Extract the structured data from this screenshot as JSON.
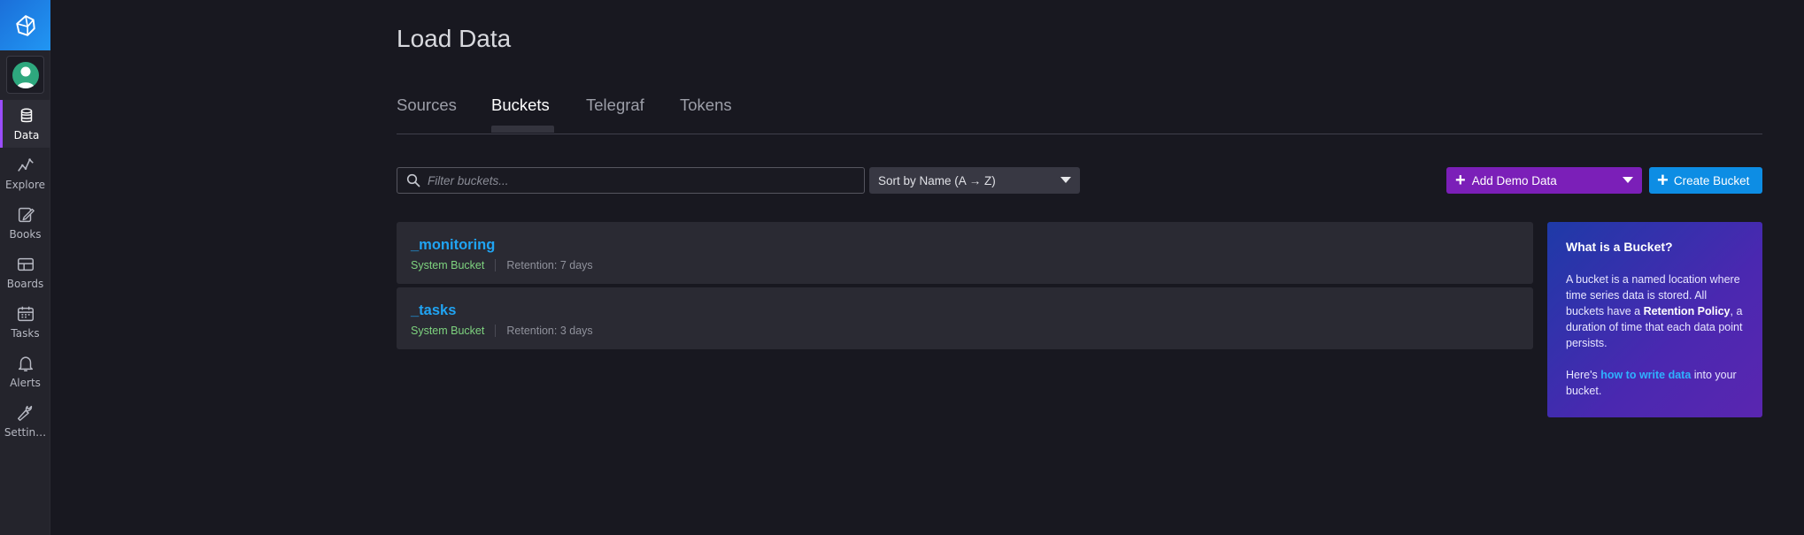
{
  "sidebar": {
    "items": [
      {
        "label": "Data",
        "icon": "database-icon",
        "active": true
      },
      {
        "label": "Explore",
        "icon": "graph-line-icon",
        "active": false
      },
      {
        "label": "Books",
        "icon": "notebook-pencil-icon",
        "active": false
      },
      {
        "label": "Boards",
        "icon": "dashboard-grid-icon",
        "active": false
      },
      {
        "label": "Tasks",
        "icon": "calendar-icon",
        "active": false
      },
      {
        "label": "Alerts",
        "icon": "bell-icon",
        "active": false
      },
      {
        "label": "Settin…",
        "icon": "wrench-icon",
        "active": false
      }
    ]
  },
  "header": {
    "title": "Load Data"
  },
  "tabs": [
    {
      "label": "Sources",
      "active": false
    },
    {
      "label": "Buckets",
      "active": true
    },
    {
      "label": "Telegraf",
      "active": false
    },
    {
      "label": "Tokens",
      "active": false
    }
  ],
  "toolbar": {
    "filter_placeholder": "Filter buckets...",
    "sort_label": "Sort by Name (A → Z)",
    "demo_label": "Add Demo Data",
    "create_label": "Create Bucket"
  },
  "buckets": [
    {
      "name": "_monitoring",
      "type": "System Bucket",
      "retention": "Retention: 7 days"
    },
    {
      "name": "_tasks",
      "type": "System Bucket",
      "retention": "Retention: 3 days"
    }
  ],
  "info": {
    "title": "What is a Bucket?",
    "p1_before": "A bucket is a named location where time series data is stored. All buckets have a ",
    "p1_bold": "Retention Policy",
    "p1_after": ", a duration of time that each data point persists.",
    "p2_before": "Here's ",
    "p2_link": "how to write data",
    "p2_after": " into your bucket."
  },
  "colors": {
    "accent_purple": "#7b1fb8",
    "accent_blue": "#0d8de4",
    "bucket_name": "#20a4f3",
    "system_green": "#7ed37f"
  }
}
